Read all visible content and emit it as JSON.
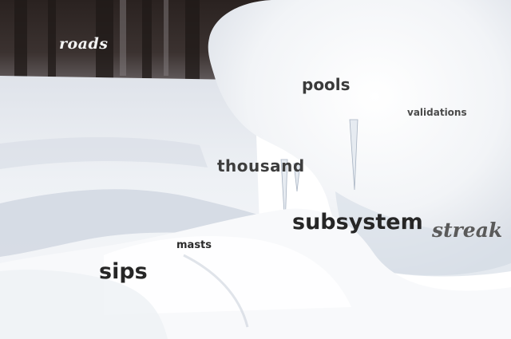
{
  "scene": {
    "subject": "snow-covered ground with icicles",
    "colors": {
      "snow": "#f4f6f9",
      "shadow": "#c9d2de",
      "trees": "#2e2724"
    }
  },
  "words": {
    "roads": "roads",
    "pools": "pools",
    "validations": "validations",
    "thousand": "thousand",
    "subsystem": "subsystem",
    "streak": "streak",
    "masts": "masts",
    "sips": "sips"
  }
}
